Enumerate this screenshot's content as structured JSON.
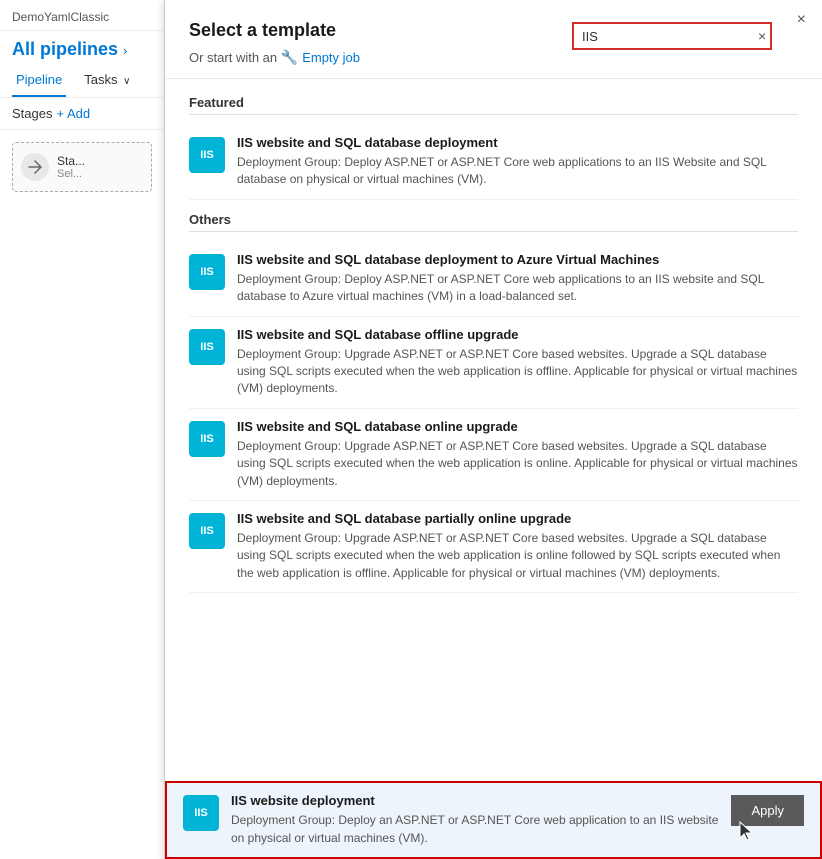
{
  "sidebar": {
    "app_name": "DemoYamlClassic",
    "breadcrumb": "All pipelines",
    "nav_items": [
      {
        "label": "Pipeline",
        "active": true
      },
      {
        "label": "Tasks",
        "active": false,
        "has_chevron": true
      }
    ],
    "stages_label": "Stages",
    "add_label": "+ Add",
    "stage_card": {
      "title": "Sta...",
      "subtitle": "Sel..."
    }
  },
  "modal": {
    "title": "Select a template",
    "subtitle_prefix": "Or start with an",
    "empty_job_label": "Empty job",
    "close_label": "×",
    "search_value": "IIS",
    "search_clear": "×",
    "featured_label": "Featured",
    "others_label": "Others",
    "templates": {
      "featured": [
        {
          "badge": "IIS",
          "name": "IIS website and SQL database deployment",
          "desc": "Deployment Group: Deploy ASP.NET or ASP.NET Core web applications to an IIS Website and SQL database on physical or virtual machines (VM)."
        }
      ],
      "others": [
        {
          "badge": "IIS",
          "name": "IIS website and SQL database deployment to Azure Virtual Machines",
          "desc": "Deployment Group: Deploy ASP.NET or ASP.NET Core web applications to an IIS website and SQL database to Azure virtual machines (VM) in a load-balanced set."
        },
        {
          "badge": "IIS",
          "name": "IIS website and SQL database offline upgrade",
          "desc": "Deployment Group: Upgrade ASP.NET or ASP.NET Core based websites. Upgrade a SQL database using SQL scripts executed when the web application is offline. Applicable for physical or virtual machines (VM) deployments."
        },
        {
          "badge": "IIS",
          "name": "IIS website and SQL database online upgrade",
          "desc": "Deployment Group: Upgrade ASP.NET or ASP.NET Core based websites. Upgrade a SQL database using SQL scripts executed when the web application is online. Applicable for physical or virtual machines (VM) deployments."
        },
        {
          "badge": "IIS",
          "name": "IIS website and SQL database partially online upgrade",
          "desc": "Deployment Group: Upgrade ASP.NET or ASP.NET Core based websites. Upgrade a SQL database using SQL scripts executed when the web application is online followed by SQL scripts executed when the web application is offline. Applicable for physical or virtual machines (VM) deployments."
        }
      ],
      "selected": {
        "badge": "IIS",
        "name": "IIS website deployment",
        "desc": "Deployment Group: Deploy an ASP.NET or ASP.NET Core web application to an IIS website on physical or virtual machines (VM).",
        "apply_label": "Apply"
      }
    }
  }
}
